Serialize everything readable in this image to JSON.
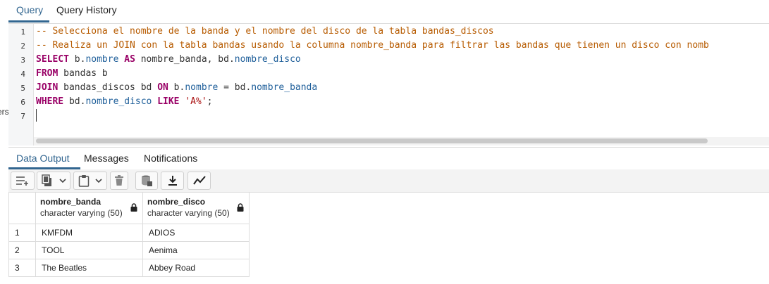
{
  "query_tabs": [
    {
      "label": "Query",
      "active": true
    },
    {
      "label": "Query History",
      "active": false
    }
  ],
  "left_edge_text": "ers",
  "editor": {
    "line_numbers": [
      "1",
      "2",
      "3",
      "4",
      "5",
      "6",
      "7"
    ],
    "lines": [
      [
        {
          "t": "cm",
          "v": "-- Selecciona el nombre de la banda y el nombre del disco de la tabla bandas_discos"
        }
      ],
      [
        {
          "t": "cm",
          "v": "-- Realiza un JOIN con la tabla bandas usando la columna nombre_banda para filtrar las bandas que tienen un disco con nomb"
        }
      ],
      [
        {
          "t": "kw",
          "v": "SELECT"
        },
        {
          "t": "id",
          "v": " b."
        },
        {
          "t": "prop",
          "v": "nombre"
        },
        {
          "t": "id",
          "v": " "
        },
        {
          "t": "kw",
          "v": "AS"
        },
        {
          "t": "id",
          "v": " nombre_banda, bd."
        },
        {
          "t": "prop",
          "v": "nombre_disco"
        }
      ],
      [
        {
          "t": "kw",
          "v": "FROM"
        },
        {
          "t": "id",
          "v": " bandas b"
        }
      ],
      [
        {
          "t": "kw",
          "v": "JOIN"
        },
        {
          "t": "id",
          "v": " bandas_discos bd "
        },
        {
          "t": "kw",
          "v": "ON"
        },
        {
          "t": "id",
          "v": " b."
        },
        {
          "t": "prop",
          "v": "nombre"
        },
        {
          "t": "id",
          "v": " = bd."
        },
        {
          "t": "prop",
          "v": "nombre_banda"
        }
      ],
      [
        {
          "t": "kw",
          "v": "WHERE"
        },
        {
          "t": "id",
          "v": " bd."
        },
        {
          "t": "prop",
          "v": "nombre_disco"
        },
        {
          "t": "id",
          "v": " "
        },
        {
          "t": "kw",
          "v": "LIKE"
        },
        {
          "t": "id",
          "v": " "
        },
        {
          "t": "str",
          "v": "'A%'"
        },
        {
          "t": "id",
          "v": ";"
        }
      ],
      []
    ]
  },
  "output_tabs": [
    {
      "label": "Data Output",
      "active": true
    },
    {
      "label": "Messages",
      "active": false
    },
    {
      "label": "Notifications",
      "active": false
    }
  ],
  "toolbar_icons": [
    "add-row-icon",
    "copy-icon",
    "chevron-down-icon",
    "paste-icon",
    "chevron-down-icon",
    "delete-icon",
    "save-data-icon",
    "download-icon",
    "graph-visualiser-icon"
  ],
  "grid": {
    "columns": [
      {
        "name": "nombre_banda",
        "type": "character varying (50)"
      },
      {
        "name": "nombre_disco",
        "type": "character varying (50)"
      }
    ],
    "rows": [
      {
        "n": "1",
        "cells": [
          "KMFDM",
          "ADIOS"
        ]
      },
      {
        "n": "2",
        "cells": [
          "TOOL",
          "Aenima"
        ]
      },
      {
        "n": "3",
        "cells": [
          "The Beatles",
          "Abbey Road"
        ]
      }
    ]
  },
  "colors": {
    "accent": "#326690",
    "keyword": "#990066",
    "comment": "#b75b00",
    "property": "#1f5f9a"
  }
}
